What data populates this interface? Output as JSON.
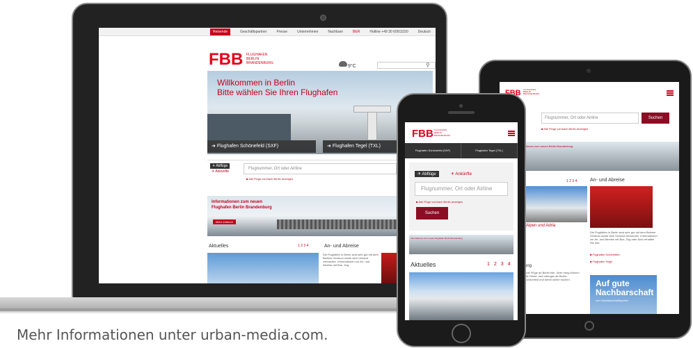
{
  "caption": "Mehr Informationen unter urban-media.com.",
  "brand": {
    "logo": "FBB",
    "name_lines": [
      "FLUGHAFEN",
      "BERLIN",
      "BRANDENBURG"
    ],
    "accent_color": "#e2001a",
    "dark_red": "#8b0d24"
  },
  "laptop": {
    "topnav": [
      "Reisende",
      "Geschäftspartner",
      "Presse",
      "Unternehmen",
      "Nachbarn",
      "BER"
    ],
    "phone": "Hotline +49 30 60911150",
    "language": "Deutsch",
    "weather": "9°C",
    "hero_title_1": "Willkommen in Berlin",
    "hero_title_2": "Bitte wählen Sie Ihren Flughafen",
    "airport_sxf": "Flughafen Schönefeld (SXF)",
    "airport_txl": "Flughafen Tegel (TXL)",
    "abfluege": "Abflüge",
    "ankunfte": "Ankünfte",
    "flight_placeholder": "Flugnummer, Ort oder Airline",
    "alle_fluege": "Alle Flüge von/nach Berlin anzeigen",
    "banner_1": "Informationen zum neuen",
    "banner_2": "Flughafen Berlin Brandenburg",
    "banner_btn": "Mehr erfahren",
    "aktuelles": "Aktuelles",
    "pager": "1  2  3  4",
    "an_abreise": "An- und Abreise",
    "an_abreise_text": "Die Flughäfen in Berlin sind sehr gut mit dem Berliner Zentrum sowie dem Umland verbunden. Informationen zur An- und Abreise mit Bus, Zug"
  },
  "tablet": {
    "search_placeholder": "Flugnummer, Ort oder Airline",
    "suchen": "Suchen",
    "alle_fluege": "Alle Flüge von/nach Berlin anzeigen",
    "banner_text": "tionen zum neuen Berlin Brandenburg",
    "pager": "1  2  3  4",
    "an_abreise": "An- und Abreise",
    "alpen": "Alpen und Adria",
    "text": "Die Flughäfen in Berlin sind sehr gut mit dem Berliner Zentrum sowie dem Umland verbunden. Informationen zur An- und Abreise mit Bus, Zug oder Auto erhalten Sie hier.",
    "link1": "Flughafen Schönefeld",
    "link2": "Flughafen Tegel",
    "ung": "ung",
    "lines": "hme Flüge ab Berlin hier. Uber rtung können Sie Direkt- und ndungen ab Berlin-Schönefeld und direkt online buchen.",
    "gute_1": "Auf gute",
    "gute_2": "Nachbarschaft",
    "gute_sub": "zum Nachbarschaftsportal"
  },
  "phone": {
    "tab_sxf": "Flughafen Schönefeld (SXF)",
    "tab_txl": "Flughafen Tegel (TXL)",
    "abfluege": "Abflüge",
    "ankunfte": "Ankünfte",
    "flight_placeholder": "Flugnummer, Ort oder Airline",
    "alle_fluege": "Alle Flüge von/nach Berlin anzeigen",
    "suchen": "Suchen",
    "banner_text": "Informationen zum neuen Flughafen Berlin Brandenburg",
    "aktuelles": "Aktuelles",
    "pager": "1234"
  }
}
